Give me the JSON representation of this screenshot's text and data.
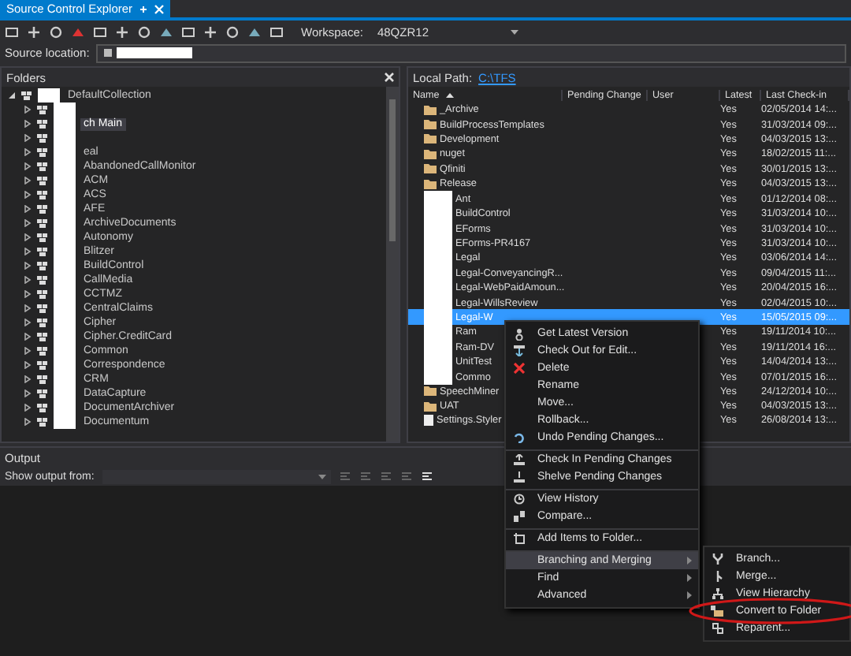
{
  "tab": {
    "title": "Source Control Explorer",
    "selected": true
  },
  "toolbar": {
    "workspace_label": "Workspace:",
    "workspace": "48QZR12"
  },
  "source_location": {
    "label": "Source location:"
  },
  "folders": {
    "title": "Folders",
    "tree": [
      {
        "label": "DefaultCollection",
        "expanded": true,
        "selected": false,
        "children": [
          {
            "expanded": false,
            "selected": false
          },
          {
            "label": "ch Main",
            "expanded": false,
            "selected": true
          },
          {
            "expanded": false,
            "selected": false
          },
          {
            "label": "eal",
            "expanded": false,
            "selected": false
          },
          {
            "label": "AbandonedCallMonitor",
            "expanded": false,
            "selected": false
          },
          {
            "label": "ACM",
            "expanded": false,
            "selected": false
          },
          {
            "label": "ACS",
            "expanded": false,
            "selected": false
          },
          {
            "label": "AFE",
            "expanded": false,
            "selected": false
          },
          {
            "label": "ArchiveDocuments",
            "expanded": false,
            "selected": false
          },
          {
            "label": "Autonomy",
            "expanded": false,
            "selected": false
          },
          {
            "label": "Blitzer",
            "expanded": false,
            "selected": false
          },
          {
            "label": "BuildControl",
            "expanded": false,
            "selected": false
          },
          {
            "label": "CallMedia",
            "expanded": false,
            "selected": false
          },
          {
            "label": "CCTMZ",
            "expanded": false,
            "selected": false
          },
          {
            "label": "CentralClaims",
            "expanded": false,
            "selected": false
          },
          {
            "label": "Cipher",
            "expanded": false,
            "selected": false
          },
          {
            "label": "Cipher.CreditCard",
            "expanded": false,
            "selected": false
          },
          {
            "label": "Common",
            "expanded": false,
            "selected": false
          },
          {
            "label": "Correspondence",
            "expanded": false,
            "selected": false
          },
          {
            "label": "CRM",
            "expanded": false,
            "selected": false
          },
          {
            "label": "DataCapture",
            "expanded": false,
            "selected": false
          },
          {
            "label": "DocumentArchiver",
            "expanded": false,
            "selected": false
          },
          {
            "label": "Documentum",
            "expanded": false,
            "selected": false
          }
        ]
      }
    ]
  },
  "files": {
    "local_path_label": "Local Path:",
    "local_path": "C:\\TFS",
    "columns": [
      "Name",
      "Pending Change",
      "User",
      "Latest",
      "Last Check-in"
    ],
    "rows": [
      {
        "name": "_Archive",
        "kind": "folder",
        "redacted": false,
        "latest": "Yes",
        "last_checkin": "02/05/2014 14:...",
        "selected": false
      },
      {
        "name": "BuildProcessTemplates",
        "kind": "folder",
        "redacted": false,
        "latest": "Yes",
        "last_checkin": "31/03/2014 09:...",
        "selected": false
      },
      {
        "name": "Development",
        "kind": "folder",
        "redacted": false,
        "latest": "Yes",
        "last_checkin": "04/03/2015 13:...",
        "selected": false
      },
      {
        "name": "nuget",
        "kind": "folder",
        "redacted": false,
        "latest": "Yes",
        "last_checkin": "18/02/2015 11:...",
        "selected": false
      },
      {
        "name": "Qfiniti",
        "kind": "folder",
        "redacted": false,
        "latest": "Yes",
        "last_checkin": "30/01/2015 13:...",
        "selected": false
      },
      {
        "name": "Release",
        "kind": "folder",
        "redacted": false,
        "latest": "Yes",
        "last_checkin": "04/03/2015 13:...",
        "selected": false
      },
      {
        "name": "Ant",
        "redacted": true,
        "latest": "Yes",
        "last_checkin": "01/12/2014 08:...",
        "selected": false
      },
      {
        "name": "BuildControl",
        "redacted": true,
        "latest": "Yes",
        "last_checkin": "31/03/2014 10:...",
        "selected": false
      },
      {
        "name": "EForms",
        "redacted": true,
        "latest": "Yes",
        "last_checkin": "31/03/2014 10:...",
        "selected": false
      },
      {
        "name": "EForms-PR4167",
        "redacted": true,
        "latest": "Yes",
        "last_checkin": "31/03/2014 10:...",
        "selected": false
      },
      {
        "name": "Legal",
        "redacted": true,
        "latest": "Yes",
        "last_checkin": "03/06/2014 14:...",
        "selected": false
      },
      {
        "name": "Legal-ConveyancingR...",
        "redacted": true,
        "latest": "Yes",
        "last_checkin": "09/04/2015 11:...",
        "selected": false
      },
      {
        "name": "Legal-WebPaidAmoun...",
        "redacted": true,
        "latest": "Yes",
        "last_checkin": "20/04/2015 16:...",
        "selected": false
      },
      {
        "name": "Legal-WillsReview",
        "redacted": true,
        "latest": "Yes",
        "last_checkin": "02/04/2015 10:...",
        "selected": false
      },
      {
        "name": "Legal-W",
        "redacted": true,
        "latest": "Yes",
        "last_checkin": "15/05/2015 09:...",
        "selected": true
      },
      {
        "name": "Ram",
        "redacted": true,
        "latest": "Yes",
        "last_checkin": "19/11/2014 10:...",
        "selected": false
      },
      {
        "name": "Ram-DV",
        "redacted": true,
        "latest": "Yes",
        "last_checkin": "19/11/2014 16:...",
        "selected": false
      },
      {
        "name": "UnitTest",
        "redacted": true,
        "latest": "Yes",
        "last_checkin": "14/04/2014 13:...",
        "selected": false
      },
      {
        "name": "Commo",
        "redacted": true,
        "latest": "Yes",
        "last_checkin": "07/01/2015 16:...",
        "selected": false
      },
      {
        "name": "SpeechMiner",
        "kind": "folder",
        "redacted": false,
        "latest": "Yes",
        "last_checkin": "24/12/2014 10:...",
        "selected": false
      },
      {
        "name": "UAT",
        "kind": "folder",
        "redacted": false,
        "latest": "Yes",
        "last_checkin": "04/03/2015 13:...",
        "selected": false
      },
      {
        "name": "Settings.Styler",
        "kind": "file",
        "redacted": false,
        "latest": "Yes",
        "last_checkin": "26/08/2014 13:...",
        "selected": false
      }
    ]
  },
  "context_menu": {
    "items": [
      {
        "label": "Get Latest Version",
        "separator_before": false,
        "submenu": false,
        "selected": false
      },
      {
        "label": "Check Out for Edit...",
        "separator_before": false,
        "submenu": false,
        "selected": false
      },
      {
        "label": "Delete",
        "separator_before": false,
        "submenu": false,
        "selected": false
      },
      {
        "label": "Rename",
        "separator_before": false,
        "submenu": false,
        "selected": false
      },
      {
        "label": "Move...",
        "separator_before": false,
        "submenu": false,
        "selected": false
      },
      {
        "label": "Rollback...",
        "separator_before": false,
        "submenu": false,
        "selected": false
      },
      {
        "label": "Undo Pending Changes...",
        "separator_before": false,
        "submenu": false,
        "selected": false
      },
      {
        "label": "Check In Pending Changes",
        "separator_before": true,
        "submenu": false,
        "selected": false
      },
      {
        "label": "Shelve Pending Changes",
        "separator_before": false,
        "submenu": false,
        "selected": false
      },
      {
        "label": "View History",
        "separator_before": true,
        "submenu": false,
        "selected": false
      },
      {
        "label": "Compare...",
        "separator_before": false,
        "submenu": false,
        "selected": false
      },
      {
        "label": "Add Items to Folder...",
        "separator_before": true,
        "submenu": false,
        "selected": false
      },
      {
        "label": "Branching and Merging",
        "separator_before": true,
        "submenu": true,
        "selected": true
      },
      {
        "label": "Find",
        "separator_before": false,
        "submenu": true,
        "selected": false
      },
      {
        "label": "Advanced",
        "separator_before": false,
        "submenu": true,
        "selected": false
      }
    ]
  },
  "submenu": {
    "items": [
      {
        "label": "Branch...",
        "circled": false
      },
      {
        "label": "Merge...",
        "circled": false
      },
      {
        "label": "View Hierarchy",
        "circled": false
      },
      {
        "label": "Convert to Folder",
        "circled": true
      },
      {
        "label": "Reparent...",
        "circled": false
      }
    ]
  },
  "output": {
    "title": "Output",
    "show_from_label": "Show output from:"
  }
}
